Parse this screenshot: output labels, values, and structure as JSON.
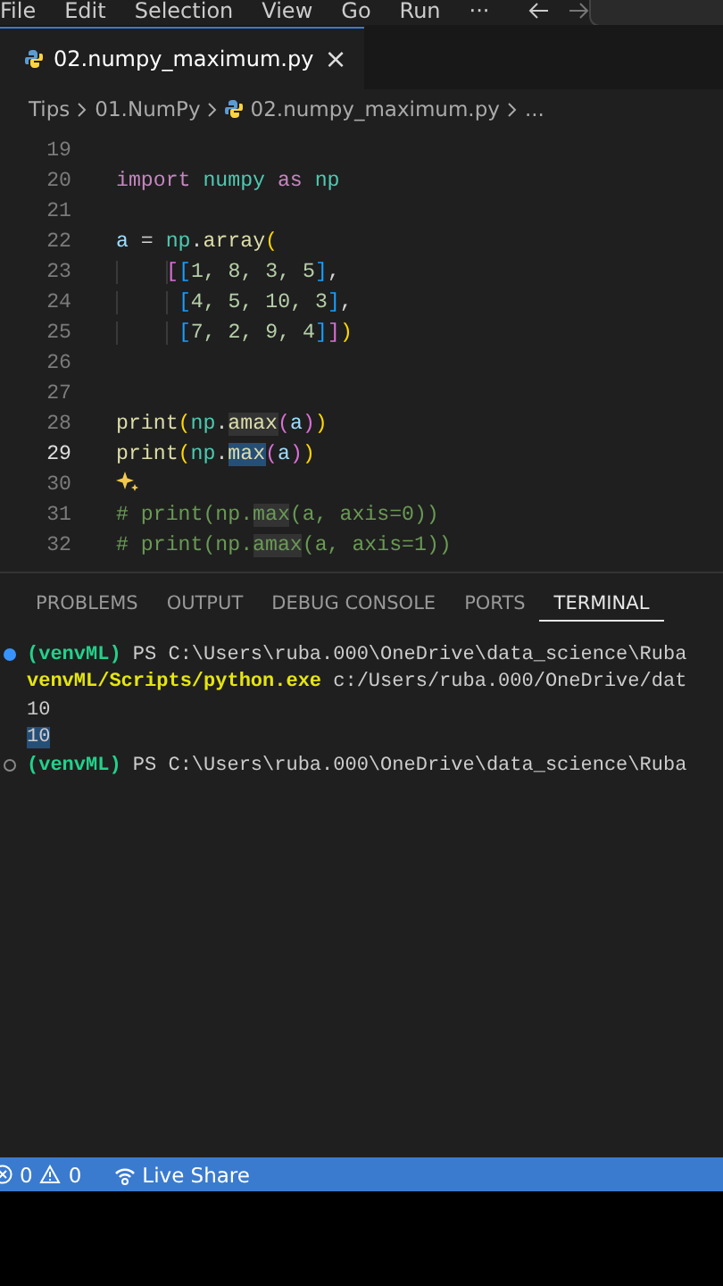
{
  "menu": [
    "File",
    "Edit",
    "Selection",
    "View",
    "Go",
    "Run",
    "···"
  ],
  "tabs": [
    {
      "label": "02.numpy_maximum.py",
      "selected": true,
      "close": "×"
    }
  ],
  "breadcrumb": [
    "Tips",
    "01.NumPy",
    "02.numpy_maximum.py",
    "..."
  ],
  "editor": {
    "lines": [
      {
        "number": "19",
        "current": false
      },
      {
        "number": "20",
        "current": false,
        "tokens": [
          {
            "text": "import",
            "kind": "keyword"
          },
          {
            "text": " numpy",
            "kind": "module"
          },
          {
            "text": " as",
            "kind": "keyword"
          },
          {
            "text": " np",
            "kind": "module"
          }
        ]
      },
      {
        "number": "21",
        "current": false
      },
      {
        "number": "22",
        "current": false,
        "tokens": [
          {
            "text": "a",
            "kind": "var"
          },
          {
            "text": " = "
          },
          {
            "text": "np",
            "kind": "module"
          },
          {
            "text": "."
          },
          {
            "text": "array",
            "kind": "func"
          },
          {
            "text": "(",
            "kind": "b1"
          }
        ]
      },
      {
        "number": "23",
        "current": false,
        "continuation": true,
        "tokens": [
          {
            "text": "[",
            "kind": "b2"
          },
          {
            "text": "[",
            "kind": "b3"
          },
          {
            "text": "1, 8, 3, 5",
            "kind": "number"
          },
          {
            "text": "]",
            "kind": "b3"
          },
          {
            "text": ","
          }
        ]
      },
      {
        "number": "24",
        "current": false,
        "continuation": true,
        "tokens": [
          {
            "text": " [",
            "kind": "b3"
          },
          {
            "text": "4, 5, 10, 3",
            "kind": "number"
          },
          {
            "text": "]",
            "kind": "b3"
          },
          {
            "text": ","
          }
        ]
      },
      {
        "number": "25",
        "current": false,
        "continuation": true,
        "tokens": [
          {
            "text": " [",
            "kind": "b3"
          },
          {
            "text": "7, 2, 9, 4",
            "kind": "number"
          },
          {
            "text": "]",
            "kind": "b3"
          },
          {
            "text": "]",
            "kind": "b2"
          },
          {
            "text": ")",
            "kind": "b1"
          }
        ]
      },
      {
        "number": "26",
        "current": false
      },
      {
        "number": "27",
        "current": false
      },
      {
        "number": "28",
        "current": false,
        "tokens": [
          {
            "text": "print",
            "kind": "func"
          },
          {
            "text": "(",
            "kind": "b1"
          },
          {
            "text": "np",
            "kind": "module"
          },
          {
            "text": "."
          },
          {
            "text": "amax",
            "kind": "func",
            "highlighted": true
          },
          {
            "text": "(",
            "kind": "b2"
          },
          {
            "text": "a",
            "kind": "var"
          },
          {
            "text": ")",
            "kind": "b2"
          },
          {
            "text": ")",
            "kind": "b1"
          }
        ]
      },
      {
        "number": "29",
        "current": true,
        "tokens": [
          {
            "text": "print",
            "kind": "func"
          },
          {
            "text": "(",
            "kind": "b1"
          },
          {
            "text": "np",
            "kind": "module"
          },
          {
            "text": "."
          },
          {
            "text": "max",
            "kind": "func",
            "selected": true
          },
          {
            "text": "(",
            "kind": "b2"
          },
          {
            "text": "a",
            "kind": "var"
          },
          {
            "text": ")",
            "kind": "b2"
          },
          {
            "text": ")",
            "kind": "b1"
          }
        ]
      },
      {
        "number": "30",
        "current": false,
        "sparkle": true
      },
      {
        "number": "31",
        "current": false,
        "tokens": [
          {
            "text": "# print(np.",
            "kind": "comment"
          },
          {
            "text": "max",
            "kind": "comment",
            "highlighted": true
          },
          {
            "text": "(a, axis=0))",
            "kind": "comment"
          }
        ]
      },
      {
        "number": "32",
        "current": false,
        "tokens": [
          {
            "text": "# print(np.",
            "kind": "comment"
          },
          {
            "text": "amax",
            "kind": "comment",
            "highlighted": true
          },
          {
            "text": "(a, axis=1))",
            "kind": "comment"
          }
        ]
      }
    ]
  },
  "panel": {
    "tabs": [
      {
        "label": "PROBLEMS",
        "selected": false
      },
      {
        "label": "OUTPUT",
        "selected": false
      },
      {
        "label": "DEBUG CONSOLE",
        "selected": false
      },
      {
        "label": "PORTS",
        "selected": false
      },
      {
        "label": "TERMINAL",
        "selected": true
      }
    ],
    "terminal": [
      {
        "succeeded": true,
        "tokens": [
          {
            "text": "(venvML)",
            "kind": "env"
          },
          {
            "text": " PS C:\\Users\\ruba.000\\OneDrive\\data_science\\Ruba"
          }
        ]
      },
      {
        "tokens": [
          {
            "text": "venvML/Scripts/python.exe",
            "kind": "command"
          },
          {
            "text": " c:/Users/ruba.000/OneDrive/dat"
          }
        ]
      },
      {
        "tokens": [
          {
            "text": "10"
          }
        ]
      },
      {
        "tokens": [
          {
            "text": "10",
            "selected": true
          }
        ]
      },
      {
        "succeeded": false,
        "tokens": [
          {
            "text": "(venvML)",
            "kind": "env"
          },
          {
            "text": " PS C:\\Users\\ruba.000\\OneDrive\\data_science\\Ruba"
          }
        ]
      }
    ]
  },
  "status_bar": {
    "errors": "0",
    "warnings": "0",
    "live_share": "Live Share"
  }
}
